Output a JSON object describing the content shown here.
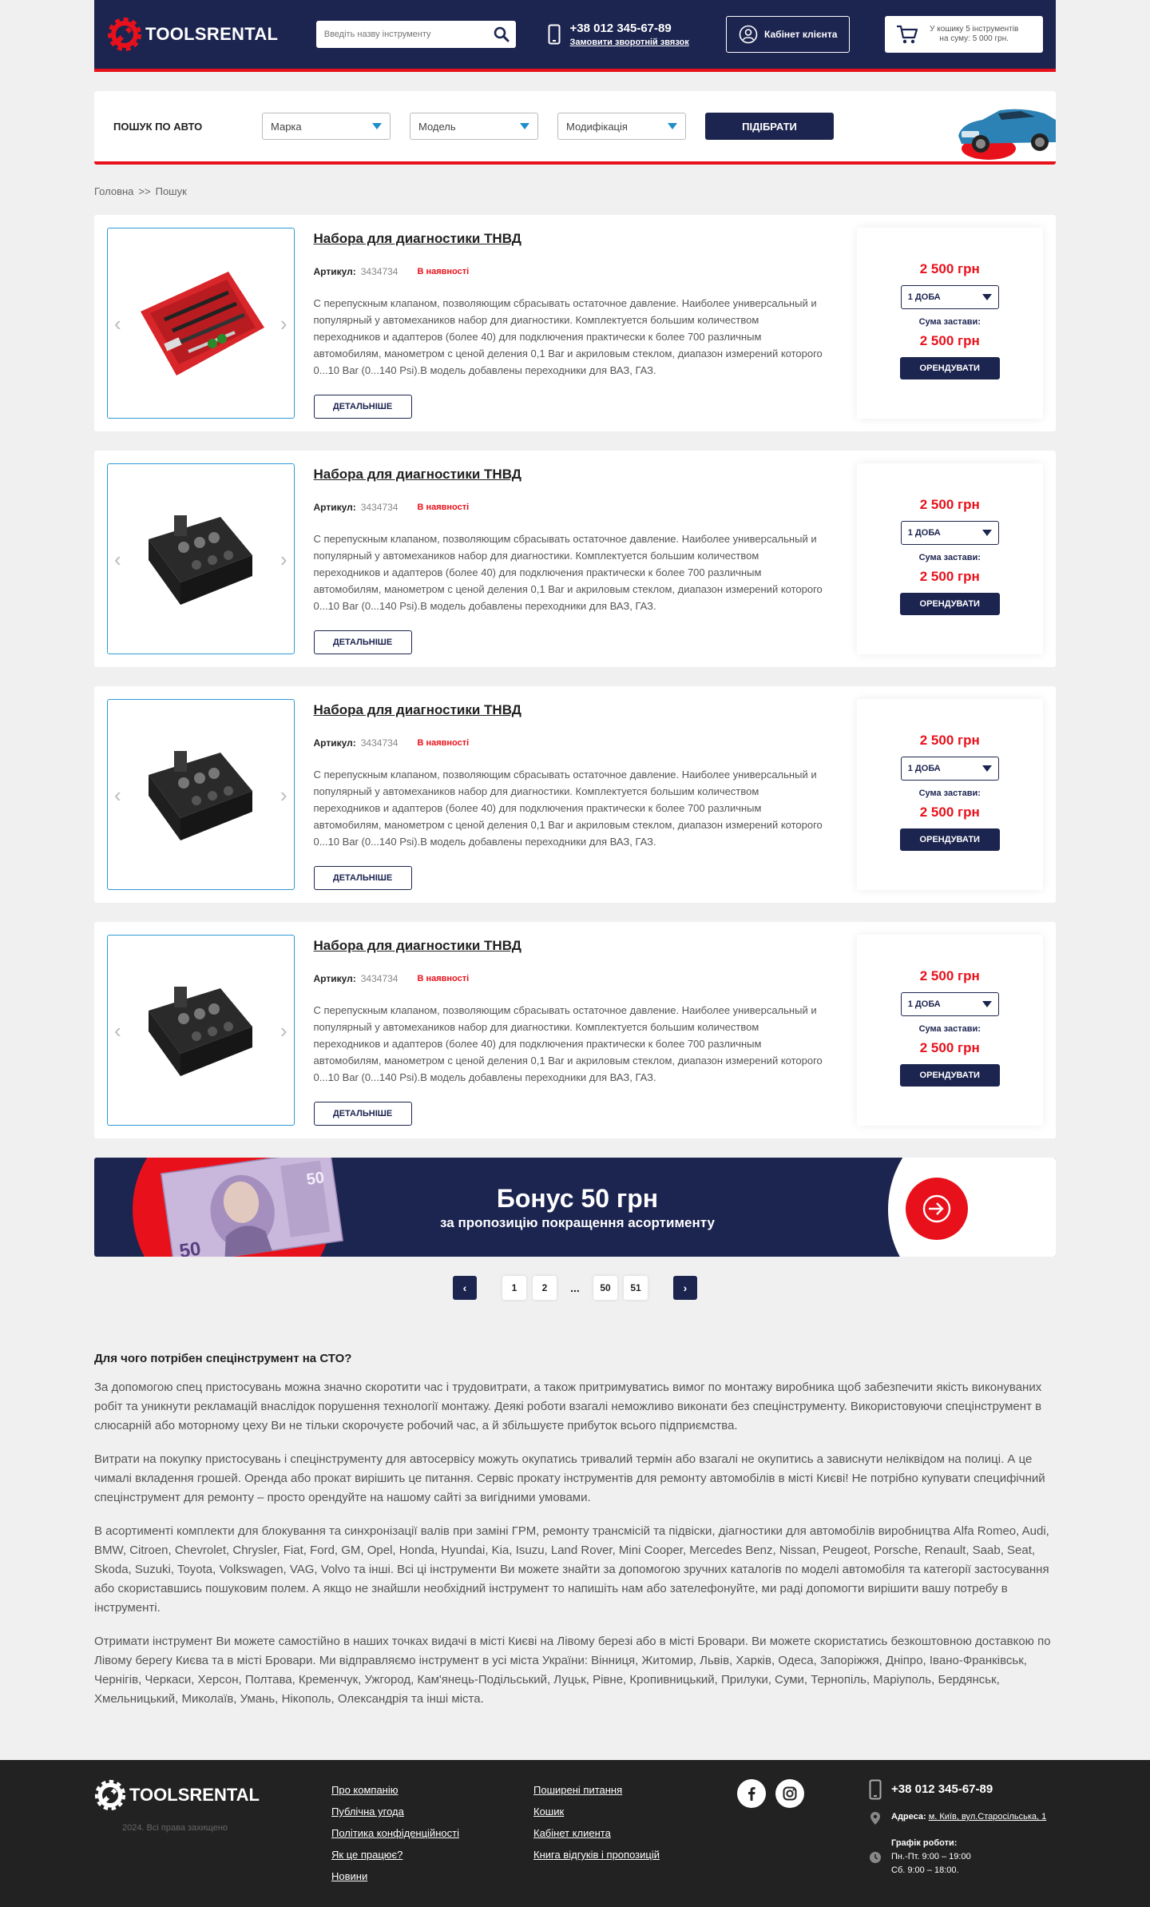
{
  "header": {
    "brand": "TOOLSRENTAL",
    "search_placeholder": "Введіть назву інструменту",
    "phone": "+38 012 345-67-89",
    "callback": "Замовити зворотній звязок",
    "cabinet": "Кабінет клієнта",
    "cart_line1": "У кошику 5 інструментів",
    "cart_line2": "на суму: 5 000 грн."
  },
  "car_search": {
    "title": "ПОШУК ПО АВТО",
    "make": "Марка",
    "model": "Модель",
    "modification": "Модифікація",
    "submit": "ПІДІБРАТИ"
  },
  "breadcrumb": {
    "home": "Головна",
    "sep": ">>",
    "current": "Пошук"
  },
  "products": [
    {
      "title": "Набора для диагностики ТНВД",
      "sku_label": "Артикул:",
      "sku": "3434734",
      "stock": "В наявності",
      "description": "С перепускным клапаном, позволяющим сбрасывать остаточное давление. Наиболее универсальный и популярный у автомехаников набор для диагностики. Комплектуется большим количеством переходников и адаптеров (более 40) для подключения практически к более 700 различным автомобилям, манометром с ценой деления 0,1 Bar и акриловым стеклом, диапазон измерений которого 0...10 Bar (0...140 Psi).В модель добавлены переходники для ВАЗ, ГАЗ.",
      "details": "ДЕТАЛЬНІШЕ",
      "price": "2 500 грн",
      "period": "1 ДОБА",
      "deposit_label": "Сума застави:",
      "deposit": "2 500 грн",
      "rent": "ОРЕНДУВАТИ",
      "image": "red-case"
    },
    {
      "title": "Набора для диагностики ТНВД",
      "sku_label": "Артикул:",
      "sku": "3434734",
      "stock": "В наявності",
      "description": "С перепускным клапаном, позволяющим сбрасывать остаточное давление. Наиболее универсальный и популярный у автомехаников набор для диагностики. Комплектуется большим количеством переходников и адаптеров (более 40) для подключения практически к более 700 различным автомобилям, манометром с ценой деления 0,1 Bar и акриловым стеклом, диапазон измерений которого 0...10 Bar (0...140 Psi).В модель добавлены переходники для ВАЗ, ГАЗ.",
      "details": "ДЕТАЛЬНІШЕ",
      "price": "2 500 грн",
      "period": "1 ДОБА",
      "deposit_label": "Сума застави:",
      "deposit": "2 500 грн",
      "rent": "ОРЕНДУВАТИ",
      "image": "black-case"
    },
    {
      "title": "Набора для диагностики ТНВД",
      "sku_label": "Артикул:",
      "sku": "3434734",
      "stock": "В наявності",
      "description": "С перепускным клапаном, позволяющим сбрасывать остаточное давление. Наиболее универсальный и популярный у автомехаников набор для диагностики. Комплектуется большим количеством переходников и адаптеров (более 40) для подключения практически к более 700 различным автомобилям, манометром с ценой деления 0,1 Bar и акриловым стеклом, диапазон измерений которого 0...10 Bar (0...140 Psi).В модель добавлены переходники для ВАЗ, ГАЗ.",
      "details": "ДЕТАЛЬНІШЕ",
      "price": "2 500 грн",
      "period": "1 ДОБА",
      "deposit_label": "Сума застави:",
      "deposit": "2 500 грн",
      "rent": "ОРЕНДУВАТИ",
      "image": "black-case"
    },
    {
      "title": "Набора для диагностики ТНВД",
      "sku_label": "Артикул:",
      "sku": "3434734",
      "stock": "В наявності",
      "description": "С перепускным клапаном, позволяющим сбрасывать остаточное давление. Наиболее универсальный и популярный у автомехаников набор для диагностики. Комплектуется большим количеством переходников и адаптеров (более 40) для подключения практически к более 700 различным автомобилям, манометром с ценой деления 0,1 Bar и акриловым стеклом, диапазон измерений которого 0...10 Bar (0...140 Psi).В модель добавлены переходники для ВАЗ, ГАЗ.",
      "details": "ДЕТАЛЬНІШЕ",
      "price": "2 500 грн",
      "period": "1 ДОБА",
      "deposit_label": "Сума застави:",
      "deposit": "2 500 грн",
      "rent": "ОРЕНДУВАТИ",
      "image": "black-case"
    }
  ],
  "banner": {
    "title": "Бонус 50 грн",
    "subtitle": "за пропозицію покращення асортименту",
    "note_value": "50"
  },
  "pagination": {
    "pages": [
      "1",
      "2"
    ],
    "dots": "...",
    "last_pages": [
      "50",
      "51"
    ],
    "prev": "‹",
    "next": "›"
  },
  "seo": {
    "heading": "Для чого потрібен спецінструмент на СТО?",
    "paragraphs": [
      "За допомогою спец пристосувань можна значно скоротити час і трудовитрати, а також притримуватись вимог по монтажу виробника щоб забезпечити якість виконуваних робіт та уникнути рекламацій внаслідок порушення технології монтажу. Деякі роботи взагалі неможливо виконати без спецінструменту. Використовуючи спецінструмент в слюсарній або моторному цеху Ви не тільки скорочуєте робочий час, а й збільшуєте прибуток всього підприємства.",
      "Витрати на покупку пристосувань і спецінструменту для автосервісу можуть окупатись тривалий термін або взагалі не окупитись а зависнути неліквідом на полиці. А це чималі вкладення грошей. Оренда або прокат вирішить це питання. Сервіс прокату інструментів для ремонту автомобілів в місті Києві! Не потрібно купувати специфічний спецінструмент для ремонту – просто орендуйте на нашому сайті за вигідними умовами.",
      "В асортименті комплекти для блокування та синхронізації валів при заміні ГРМ, ремонту трансмісій та підвіски, діагностики для автомобілів виробництва Alfa Romeo, Audi, BMW, Citroen, Chevrolet, Chrysler, Fiat, Ford, GM, Opel, Honda, Hyundai, Kia, Isuzu, Land Rover, Mini Cooper, Mercedes Benz, Nissan, Peugeot, Porsche, Renault, Saab, Seat, Skoda, Suzuki, Toyota, Volkswagen, VAG, Volvo та інші. Всі ці інструменти Ви можете знайти за допомогою зручних каталогів по моделі автомобіля та категорії застосування або скориставшись пошуковим полем. А якщо не знайшли необхідний інструмент то напишіть нам або зателефонуйте, ми раді допомогти вирішити вашу потребу в інструменті.",
      "Отримати інструмент Ви можете самостійно в наших точках видачі в місті Києві на Лівому березі або в місті Бровари. Ви можете скористатись безкоштовною доставкою по Лівому берегу Києва та в місті Бровари. Ми відправляємо інструмент в усі міста України: Вінниця, Житомир, Львів, Харків, Одеса, Запоріжжя, Дніпро, Івано-Франківськ, Чернігів, Черкаси, Херсон, Полтава, Кременчук, Ужгород, Кам'янець-Подільський, Луцьк, Рівне, Кропивницький, Прилуки, Суми, Тернопіль, Маріуполь, Бердянськ, Хмельницький, Миколаїв, Умань, Нікополь, Олександрія та інші міста."
    ]
  },
  "footer": {
    "brand": "TOOLSRENTAL",
    "copyright": "2024. Всі права захищено",
    "col1": [
      "Про компанію",
      "Публічна угода",
      "Політика конфіденційності",
      "Як це працює?",
      "Новини"
    ],
    "col2": [
      "Поширені питання",
      "Кошик",
      "Кабінет клиента",
      "Книга відгуків і пропозицій"
    ],
    "phone": "+38 012 345-67-89",
    "address_label": "Адреса:",
    "address": "м. Київ, вул.Старосільська, 1",
    "schedule_label": "Графік роботи:",
    "schedule_weekdays": "Пн.-Пт. 9:00 – 19:00",
    "schedule_saturday": "Сб. 9:00 – 18:00."
  },
  "colors": {
    "navy": "#1c2450",
    "red": "#e8111b",
    "blue": "#2d9ad6"
  },
  "icons": [
    "logo-wrench-icon",
    "search-icon",
    "phone-icon",
    "user-icon",
    "cart-icon",
    "chevron-left-icon",
    "chevron-right-icon",
    "dropdown-icon",
    "arrow-right-circle-icon",
    "facebook-icon",
    "instagram-icon",
    "map-pin-icon",
    "clock-icon"
  ]
}
